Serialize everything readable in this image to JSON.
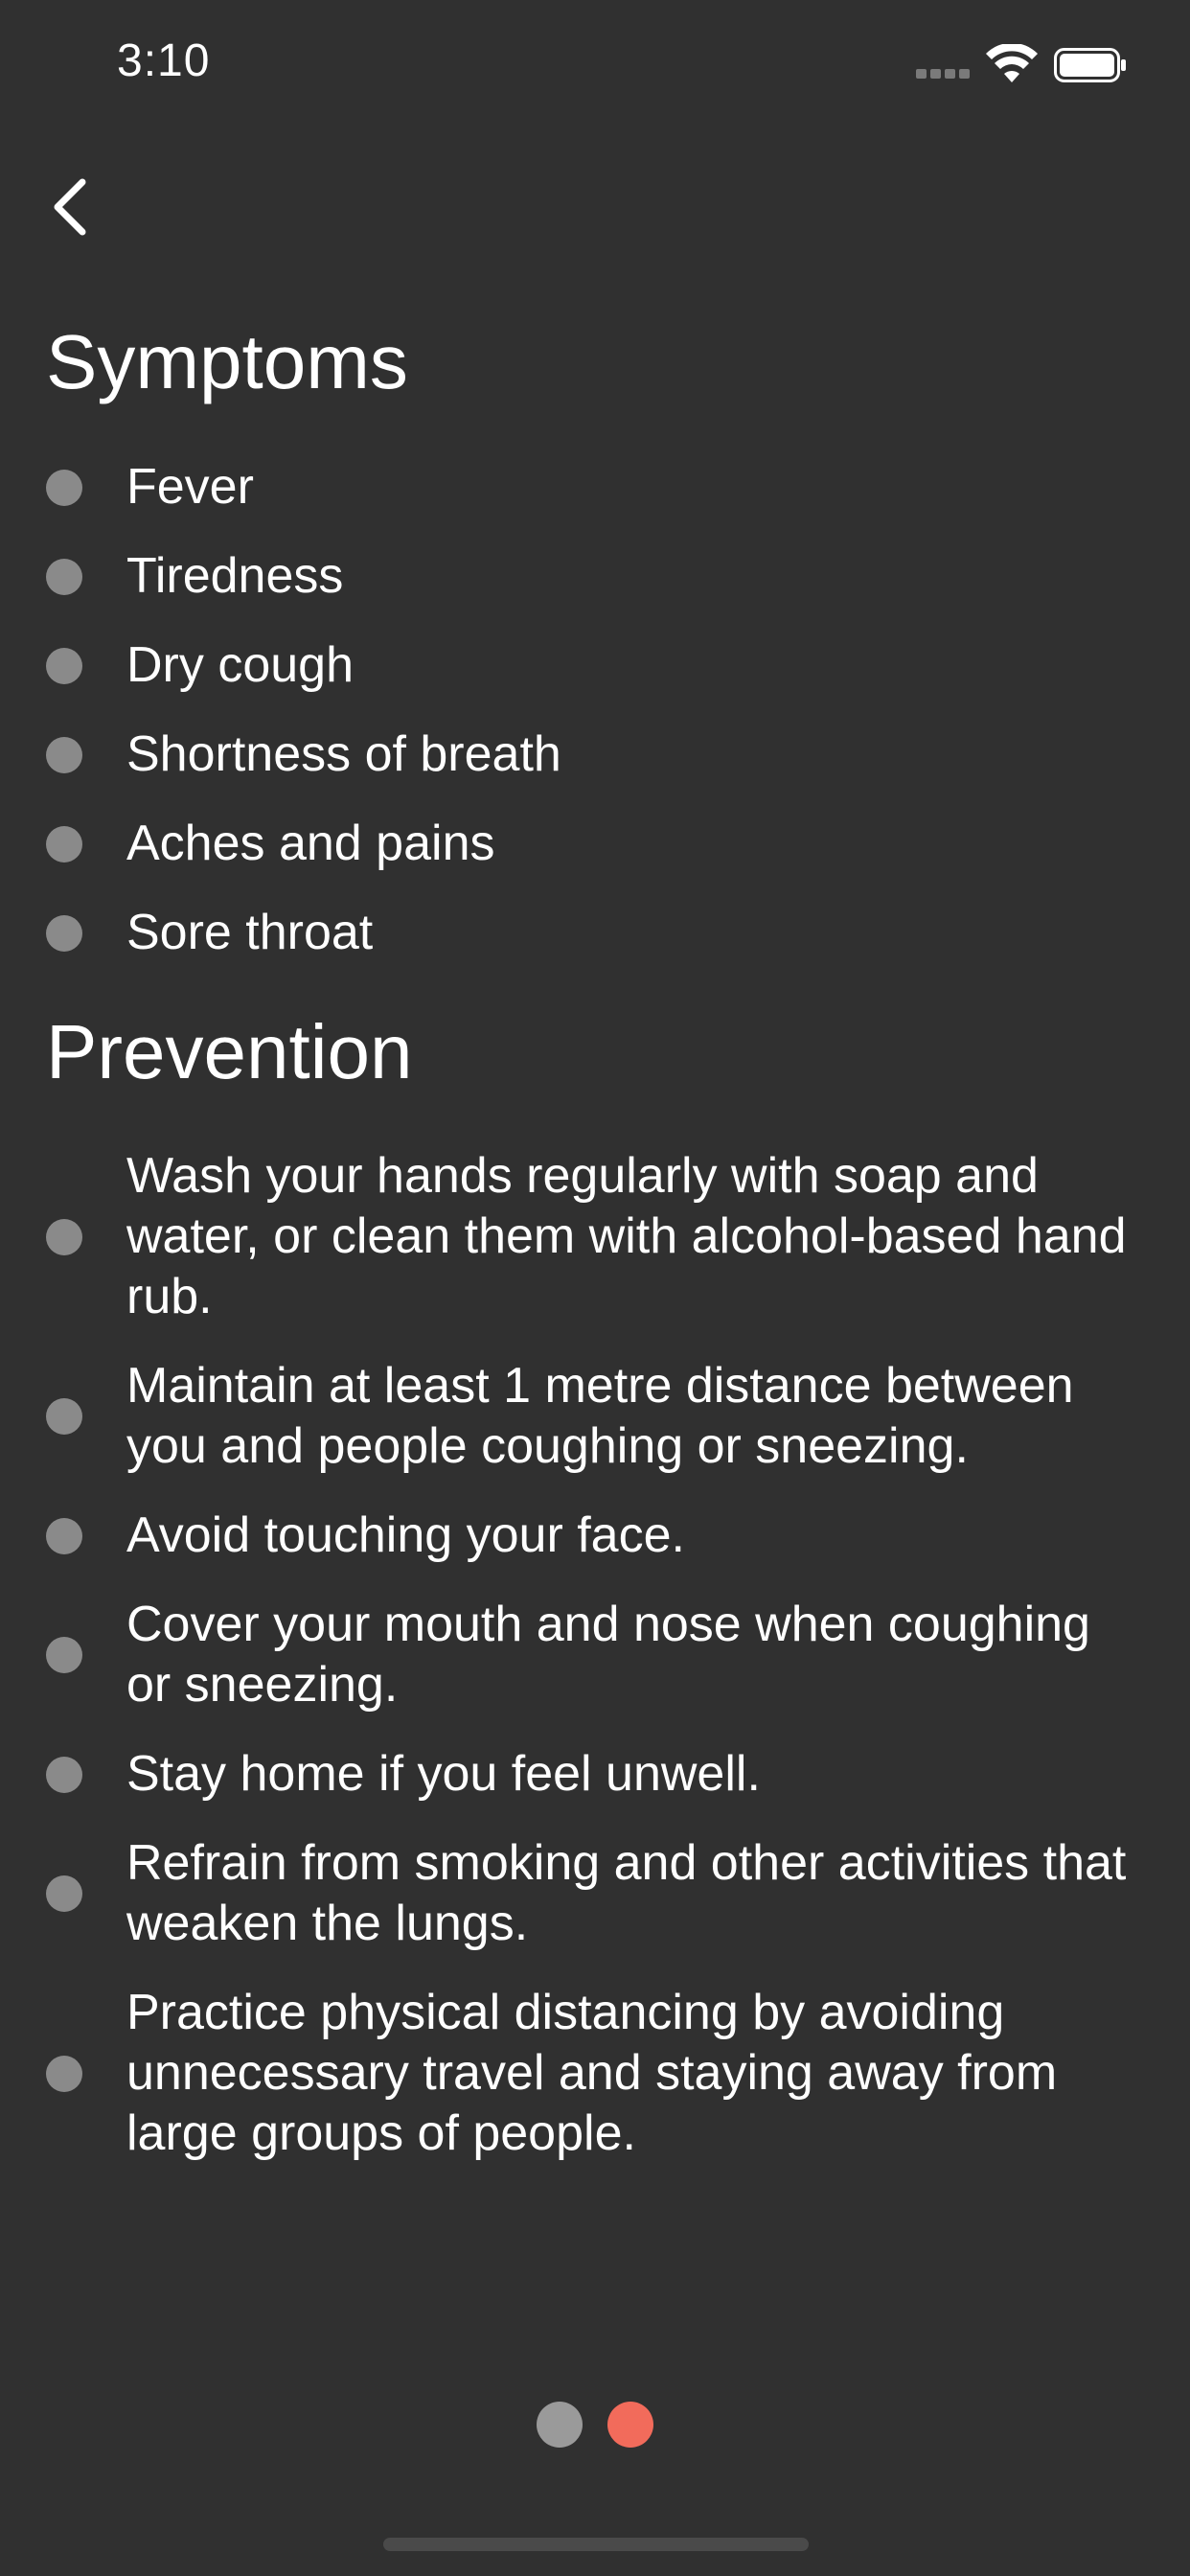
{
  "status_bar": {
    "time": "3:10"
  },
  "nav": {
    "back_icon": "chevron-left-icon"
  },
  "symptoms": {
    "title": "Symptoms",
    "items": [
      "Fever",
      "Tiredness",
      "Dry cough",
      "Shortness of breath",
      "Aches and pains",
      "Sore throat"
    ]
  },
  "prevention": {
    "title": "Prevention",
    "items": [
      "Wash your hands regularly with soap and water, or clean them with alcohol-based hand rub.",
      "Maintain at least 1 metre distance between you and people coughing or sneezing.",
      "Avoid touching your face.",
      "Cover your mouth and nose when coughing or sneezing.",
      "Stay home if you feel unwell.",
      "Refrain from smoking and other activities that weaken the lungs.",
      "Practice physical distancing by avoiding unnecessary travel and staying away from large groups of people."
    ]
  },
  "pager": {
    "page_count": 2,
    "current_page": 2,
    "colors": {
      "inactive": "#9a9a9a",
      "active": "#f26b5b"
    }
  },
  "colors": {
    "background": "#303030",
    "bullet": "#8a8a8a",
    "text": "#ffffff"
  }
}
